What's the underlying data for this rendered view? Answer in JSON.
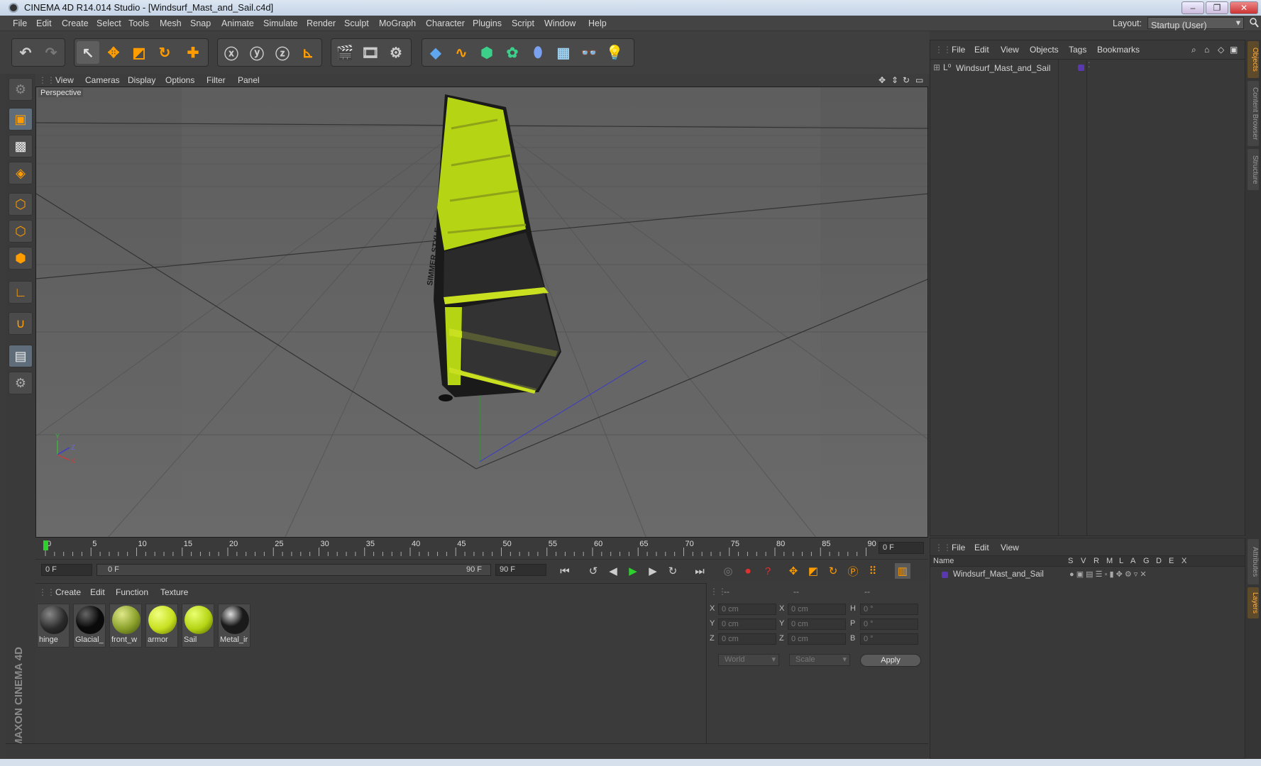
{
  "window": {
    "title": "CINEMA 4D R14.014 Studio - [Windsurf_Mast_and_Sail.c4d]",
    "controls": [
      "minimize",
      "restore",
      "close"
    ]
  },
  "menubar": {
    "items": [
      "File",
      "Edit",
      "Create",
      "Select",
      "Tools",
      "Mesh",
      "Snap",
      "Animate",
      "Simulate",
      "Render",
      "Sculpt",
      "MoGraph",
      "Character",
      "Plugins",
      "Script",
      "Window",
      "Help"
    ],
    "layout_label": "Layout:",
    "layout_value": "Startup (User)"
  },
  "viewport": {
    "menu": [
      "View",
      "Cameras",
      "Display",
      "Options",
      "Filter",
      "Panel"
    ],
    "label": "Perspective",
    "sail_text": "SIMMER STYLE",
    "axis_labels": {
      "y": "Y",
      "z": "Z",
      "x": "X"
    }
  },
  "timeline": {
    "ticks": [
      "0",
      "5",
      "10",
      "15",
      "20",
      "25",
      "30",
      "35",
      "40",
      "45",
      "50",
      "55",
      "60",
      "65",
      "70",
      "75",
      "80",
      "85",
      "90"
    ],
    "current_frame": "0 F"
  },
  "transport": {
    "start_frame": "0 F",
    "range_start": "0 F",
    "range_end": "90 F",
    "end_frame": "90 F"
  },
  "materials": {
    "menu": [
      "Create",
      "Edit",
      "Function",
      "Texture"
    ],
    "items": [
      {
        "name": "hinge",
        "color": "#2a2a2a"
      },
      {
        "name": "Glacial_",
        "color": "#0a0a0a"
      },
      {
        "name": "front_w",
        "color": "#8aa02a"
      },
      {
        "name": "armor",
        "color": "#c8e020"
      },
      {
        "name": "Sail",
        "color": "#b4d414"
      },
      {
        "name": "Metal_ir",
        "color": "#1a1a1a"
      }
    ]
  },
  "coordinates": {
    "headers": [
      "--",
      "--",
      "--"
    ],
    "rows": [
      {
        "pos_label": "X",
        "pos": "0 cm",
        "size_label": "X",
        "size": "0 cm",
        "rot_label": "H",
        "rot": "0 °"
      },
      {
        "pos_label": "Y",
        "pos": "0 cm",
        "size_label": "Y",
        "size": "0 cm",
        "rot_label": "P",
        "rot": "0 °"
      },
      {
        "pos_label": "Z",
        "pos": "0 cm",
        "size_label": "Z",
        "size": "0 cm",
        "rot_label": "B",
        "rot": "0 °"
      }
    ],
    "mode": "World",
    "size_mode": "Scale",
    "apply": "Apply"
  },
  "objects": {
    "menu": [
      "File",
      "Edit",
      "View",
      "Objects",
      "Tags",
      "Bookmarks"
    ],
    "items": [
      {
        "name": "Windsurf_Mast_and_Sail"
      }
    ]
  },
  "layers": {
    "menu": [
      "File",
      "Edit",
      "View"
    ],
    "columns": [
      "Name",
      "S",
      "V",
      "R",
      "M",
      "L",
      "A",
      "G",
      "D",
      "E",
      "X"
    ],
    "items": [
      {
        "name": "Windsurf_Mast_and_Sail"
      }
    ]
  },
  "side_tabs": [
    "Objects",
    "Content Browser",
    "Structure",
    "Attributes",
    "Layers"
  ],
  "branding": "MAXON CINEMA 4D",
  "colors": {
    "sail": "#b4d414",
    "accent": "#ff9c00",
    "background": "#3b3b3b"
  }
}
